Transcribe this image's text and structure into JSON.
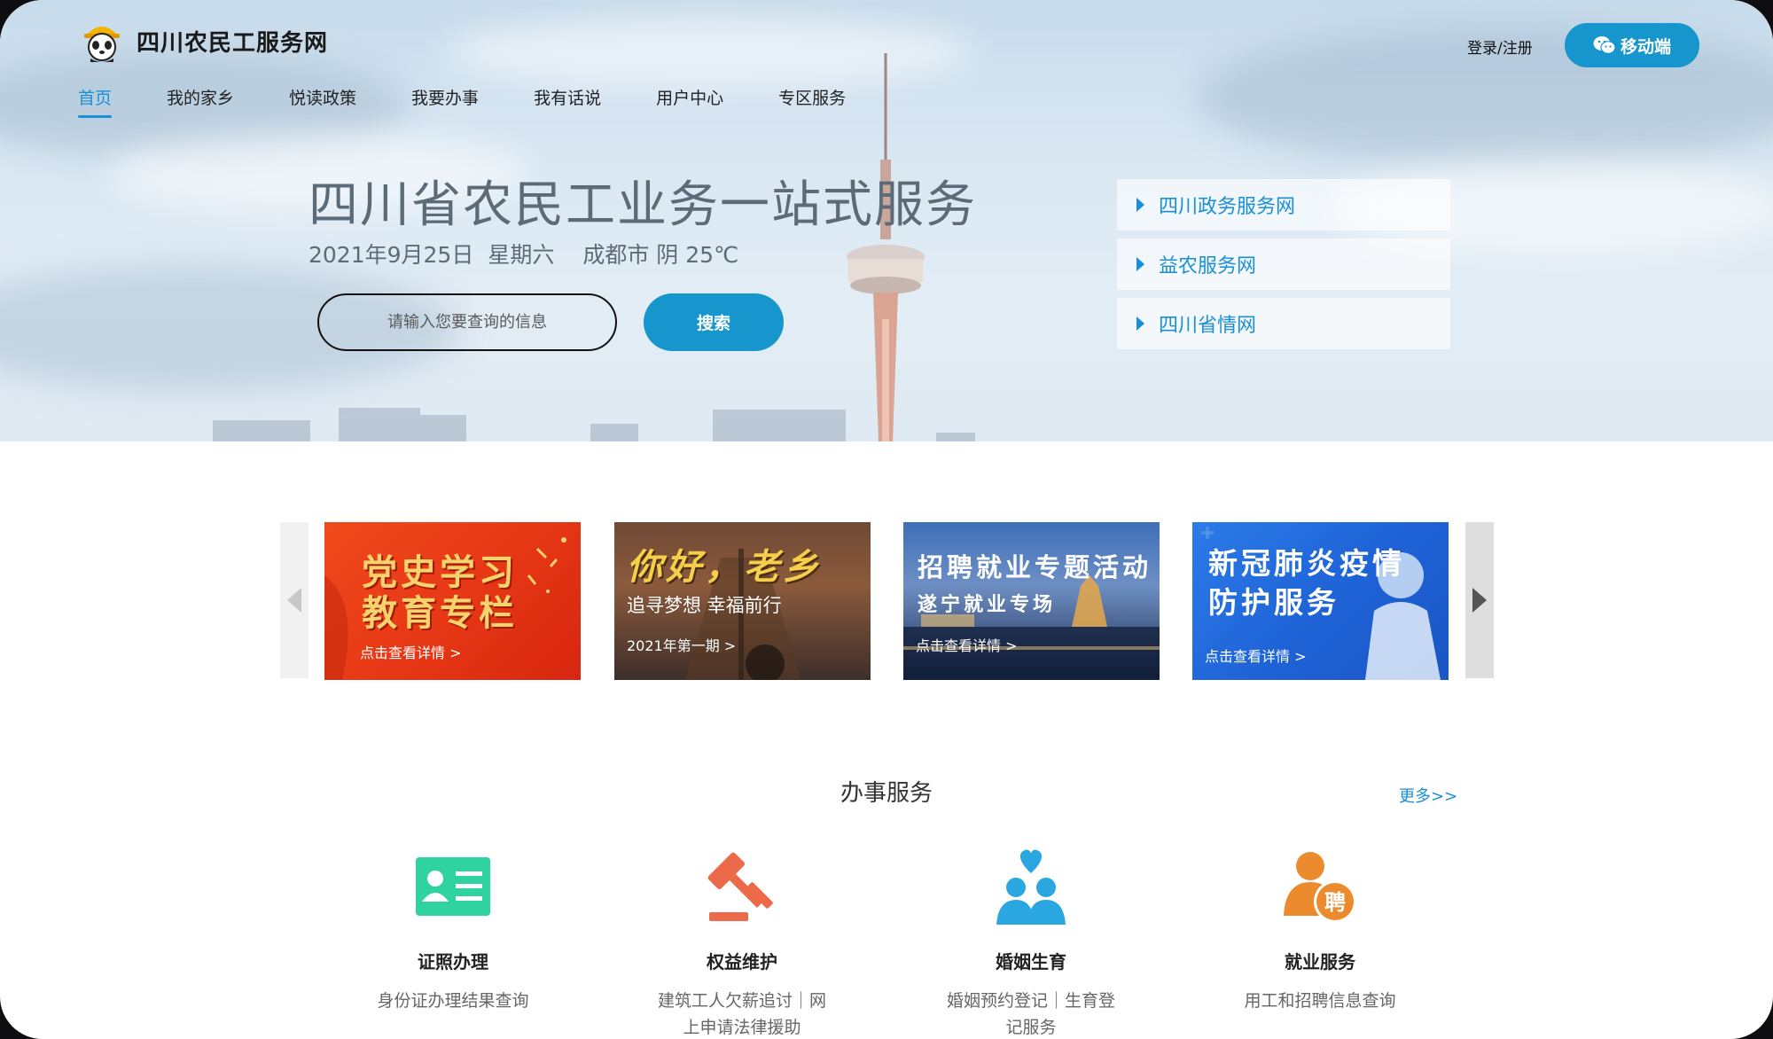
{
  "header": {
    "site_name": "四川农民工服务网",
    "login_label": "登录/注册",
    "mobile_label": "移动端"
  },
  "nav": {
    "items": [
      {
        "label": "首页",
        "active": true
      },
      {
        "label": "我的家乡"
      },
      {
        "label": "悦读政策"
      },
      {
        "label": "我要办事"
      },
      {
        "label": "我有话说"
      },
      {
        "label": "用户中心"
      },
      {
        "label": "专区服务"
      }
    ]
  },
  "hero": {
    "title": "四川省农民工业务一站式服务",
    "date": "2021年9月25日",
    "weekday": "星期六",
    "weather": "成都市 阴 25℃",
    "search_placeholder": "请输入您要查询的信息",
    "search_label": "搜索"
  },
  "quick_links": [
    {
      "label": "四川政务服务网"
    },
    {
      "label": "益农服务网"
    },
    {
      "label": "四川省情网"
    }
  ],
  "carousel": [
    {
      "title_line1": "党史学习",
      "title_line2": "教育专栏",
      "detail": "点击查看详情 >"
    },
    {
      "title_line1": "你好，老乡",
      "subtitle": "追寻梦想 幸福前行",
      "detail": "2021年第一期 >"
    },
    {
      "title_line1": "招聘就业专题活动",
      "title_line2": "遂宁就业专场",
      "detail": "点击查看详情 >"
    },
    {
      "title_line1": "新冠肺炎疫情",
      "title_line2": "防护服务",
      "detail": "点击查看详情 >"
    }
  ],
  "services": {
    "title": "办事服务",
    "more_label": "更多>>",
    "items": [
      {
        "name": "证照办理",
        "desc": "身份证办理结果查询",
        "icon": "id-card-icon",
        "color": "#2ed3a0"
      },
      {
        "name": "权益维护",
        "desc": "建筑工人欠薪追讨｜网上申请法律援助",
        "icon": "gavel-icon",
        "color": "#ec6a4a"
      },
      {
        "name": "婚姻生育",
        "desc": "婚姻预约登记｜生育登记服务",
        "icon": "couple-heart-icon",
        "color": "#2aa7e0"
      },
      {
        "name": "就业服务",
        "desc": "用工和招聘信息查询",
        "icon": "recruit-icon",
        "color": "#ec8b2e"
      }
    ]
  },
  "colors": {
    "accent": "#1696cd",
    "link": "#1a8fd6"
  }
}
